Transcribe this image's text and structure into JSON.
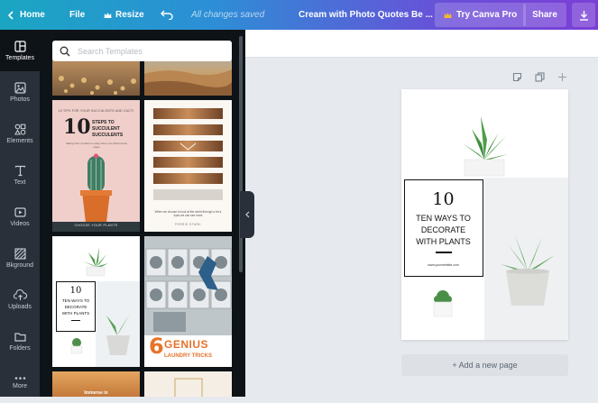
{
  "topbar": {
    "home_label": "Home",
    "file_label": "File",
    "resize_label": "Resize",
    "undo_icon": "undo-icon",
    "save_status": "All changes saved",
    "doc_title": "Cream with Photo Quotes Be ...",
    "try_pro_label": "Try Canva Pro",
    "share_label": "Share",
    "download_icon": "download-icon"
  },
  "sidebar": {
    "items": [
      {
        "label": "Templates",
        "icon": "templates-icon"
      },
      {
        "label": "Photos",
        "icon": "photos-icon"
      },
      {
        "label": "Elements",
        "icon": "elements-icon"
      },
      {
        "label": "Text",
        "icon": "text-icon"
      },
      {
        "label": "Videos",
        "icon": "videos-icon"
      },
      {
        "label": "Bkground",
        "icon": "background-icon"
      },
      {
        "label": "Uploads",
        "icon": "uploads-icon"
      },
      {
        "label": "Folders",
        "icon": "folders-icon"
      },
      {
        "label": "More",
        "icon": "more-icon"
      }
    ]
  },
  "templates": {
    "search_placeholder": "Search Templates",
    "cards": {
      "succulents": {
        "top_text": "10 TIPS FOR YOUR SUCCULENTS AND CACTI",
        "number": "10",
        "title_line1": "STEPS TO",
        "title_line2": "SUCCULENT",
        "title_line3": "SUCCULENTS",
        "sub": "Taking care of plants is easy when you follow these steps",
        "footer": "CHOOSE YOUR PLANTS"
      },
      "fox": {
        "quote": "When we choose to look at the world through a fox's eyes we can see more",
        "author": "FERRIS STARK"
      },
      "plants": {
        "number": "10",
        "line1": "TEN WAYS TO",
        "line2": "DECORATE",
        "line3": "WITH PLANTS"
      },
      "laundry": {
        "number": "6",
        "word": "GENIUS",
        "sub": "LAUNDRY TRICKS"
      },
      "immerse": {
        "text": "Immerse in"
      }
    }
  },
  "canvas": {
    "page_tool_icons": [
      "note-icon",
      "duplicate-icon",
      "add-icon"
    ],
    "design": {
      "number": "10",
      "line1": "TEN WAYS TO",
      "line2": "DECORATE",
      "line3": "WITH PLANTS",
      "url": "www.yourwebsite.com"
    },
    "add_page_label": "+ Add a new page"
  },
  "colors": {
    "accent_orange": "#e6732a",
    "panel_bg": "#0e1318",
    "nav_bg": "#293039"
  }
}
